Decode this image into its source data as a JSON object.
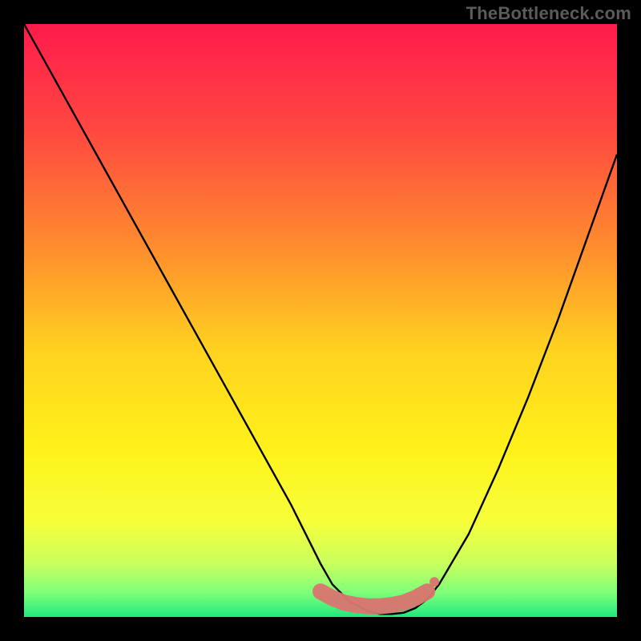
{
  "watermark": "TheBottleneck.com",
  "chart_data": {
    "type": "line",
    "title": "",
    "xlabel": "",
    "ylabel": "",
    "xlim": [
      0,
      100
    ],
    "ylim": [
      0,
      100
    ],
    "x": [
      0,
      5,
      10,
      15,
      20,
      25,
      30,
      35,
      40,
      45,
      48,
      50,
      52,
      55,
      58,
      60,
      62,
      64,
      66,
      68,
      70,
      75,
      80,
      85,
      90,
      95,
      100
    ],
    "y": [
      100,
      91,
      82,
      73,
      64,
      55,
      46,
      37,
      28,
      19,
      13,
      9,
      5.5,
      2.5,
      1.0,
      0.5,
      0.5,
      0.7,
      1.5,
      3.0,
      5.5,
      14,
      25,
      37,
      50,
      64,
      78
    ],
    "marker": {
      "x": [
        50,
        52,
        54,
        56,
        58,
        60,
        62,
        64,
        66,
        68
      ],
      "y": [
        4.3,
        3.2,
        2.4,
        2.0,
        1.8,
        1.8,
        2.0,
        2.4,
        3.2,
        4.3
      ],
      "color": "#d9766f"
    },
    "gradient_stops": [
      {
        "offset": 0.0,
        "color": "#ff1b4b"
      },
      {
        "offset": 0.18,
        "color": "#ff4840"
      },
      {
        "offset": 0.38,
        "color": "#ff8e2e"
      },
      {
        "offset": 0.55,
        "color": "#ffd21f"
      },
      {
        "offset": 0.72,
        "color": "#fff21a"
      },
      {
        "offset": 0.84,
        "color": "#f6ff3a"
      },
      {
        "offset": 0.91,
        "color": "#c9ff5e"
      },
      {
        "offset": 0.96,
        "color": "#7dff7a"
      },
      {
        "offset": 1.0,
        "color": "#20e87c"
      }
    ]
  }
}
